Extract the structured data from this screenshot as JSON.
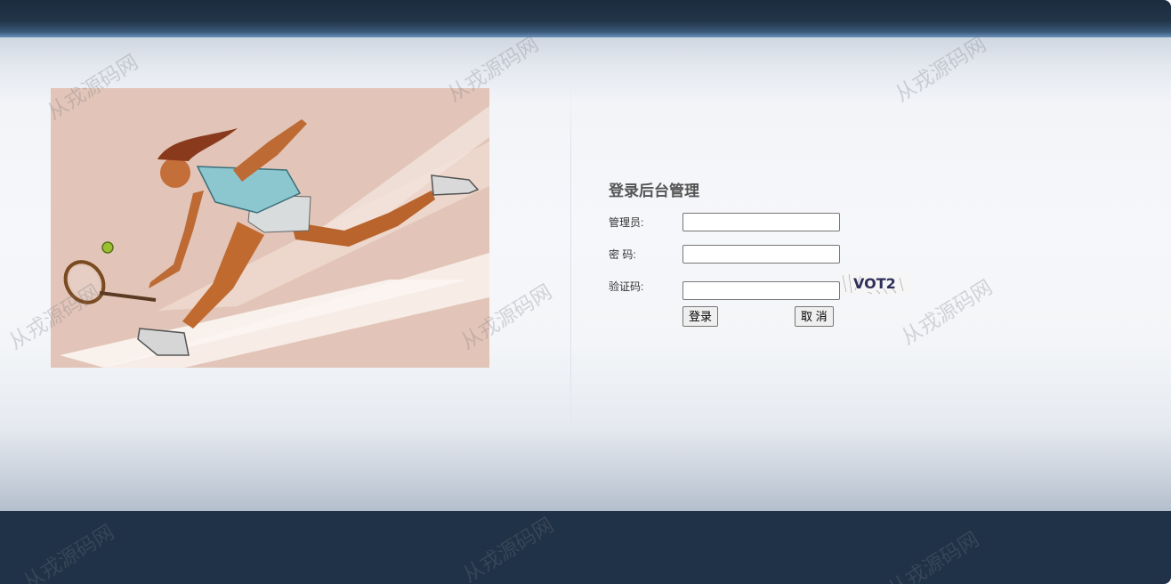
{
  "login": {
    "title": "登录后台管理",
    "username_label": "管理员:",
    "username_value": "",
    "password_label": "密 码:",
    "password_value": "",
    "captcha_label": "验证码:",
    "captcha_value": "",
    "captcha_text": "VOT2",
    "submit_label": "登录",
    "cancel_label": "取 消"
  },
  "hero_image": {
    "subject": "tennis player illustration"
  },
  "watermark": {
    "text": "从戎源码网"
  },
  "colors": {
    "header_bg": "#1c2c3f",
    "footer_bg": "#1f3247",
    "title_text": "#555555",
    "hero_bg": "#e2c5b8"
  }
}
